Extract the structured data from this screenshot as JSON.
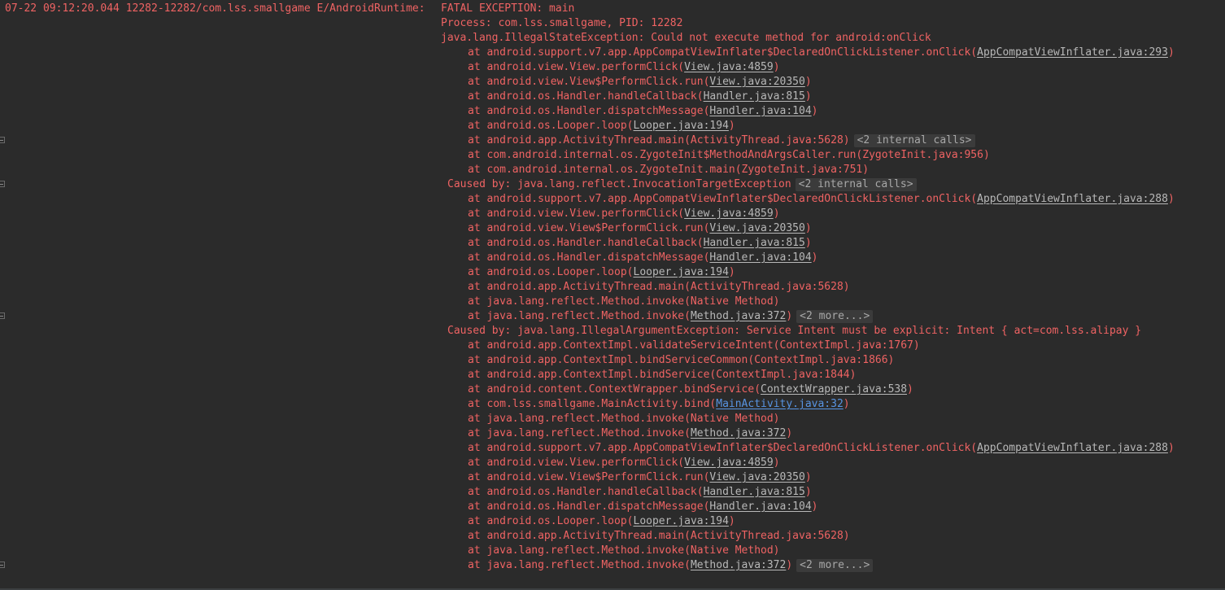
{
  "header": {
    "prefix": "07-22 09:12:20.044 12282-12282/com.lss.smallgame E/AndroidRuntime: ",
    "fatal": "FATAL EXCEPTION: main"
  },
  "lines": [
    {
      "kind": "header"
    },
    {
      "indent": 0,
      "text": "Process: com.lss.smallgame, PID: 12282"
    },
    {
      "indent": 0,
      "text": "java.lang.IllegalStateException: Could not execute method for android:onClick"
    },
    {
      "indent": 2,
      "text": "at android.support.v7.app.AppCompatViewInflater$DeclaredOnClickListener.onClick(",
      "link": "AppCompatViewInflater.java:293",
      "after": ")"
    },
    {
      "indent": 2,
      "text": "at android.view.View.performClick(",
      "link": "View.java:4859",
      "after": ")"
    },
    {
      "indent": 2,
      "text": "at android.view.View$PerformClick.run(",
      "link": "View.java:20350",
      "after": ")"
    },
    {
      "indent": 2,
      "text": "at android.os.Handler.handleCallback(",
      "link": "Handler.java:815",
      "after": ")"
    },
    {
      "indent": 2,
      "text": "at android.os.Handler.dispatchMessage(",
      "link": "Handler.java:104",
      "after": ")"
    },
    {
      "indent": 2,
      "text": "at android.os.Looper.loop(",
      "link": "Looper.java:194",
      "after": ")"
    },
    {
      "indent": 2,
      "text": "at android.app.ActivityThread.main(ActivityThread.java:5628)",
      "fold": "<2 internal calls>",
      "foldable": true
    },
    {
      "indent": 2,
      "text": "at com.android.internal.os.ZygoteInit$MethodAndArgsCaller.run(ZygoteInit.java:956)"
    },
    {
      "indent": 2,
      "text": "at com.android.internal.os.ZygoteInit.main(ZygoteInit.java:751)"
    },
    {
      "indent": 1,
      "text": "Caused by: java.lang.reflect.InvocationTargetException",
      "fold": "<2 internal calls>",
      "foldable": true
    },
    {
      "indent": 2,
      "text": "at android.support.v7.app.AppCompatViewInflater$DeclaredOnClickListener.onClick(",
      "link": "AppCompatViewInflater.java:288",
      "after": ")"
    },
    {
      "indent": 2,
      "text": "at android.view.View.performClick(",
      "link": "View.java:4859",
      "after": ")"
    },
    {
      "indent": 2,
      "text": "at android.view.View$PerformClick.run(",
      "link": "View.java:20350",
      "after": ")"
    },
    {
      "indent": 2,
      "text": "at android.os.Handler.handleCallback(",
      "link": "Handler.java:815",
      "after": ")"
    },
    {
      "indent": 2,
      "text": "at android.os.Handler.dispatchMessage(",
      "link": "Handler.java:104",
      "after": ")"
    },
    {
      "indent": 2,
      "text": "at android.os.Looper.loop(",
      "link": "Looper.java:194",
      "after": ")"
    },
    {
      "indent": 2,
      "text": "at android.app.ActivityThread.main(ActivityThread.java:5628)"
    },
    {
      "indent": 2,
      "text": "at java.lang.reflect.Method.invoke(Native Method)"
    },
    {
      "indent": 2,
      "text": "at java.lang.reflect.Method.invoke(",
      "link": "Method.java:372",
      "after": ")",
      "fold": "<2 more...>",
      "foldable": true
    },
    {
      "indent": 1,
      "text": "Caused by: java.lang.IllegalArgumentException: Service Intent must be explicit: Intent { act=com.lss.alipay }"
    },
    {
      "indent": 2,
      "text": "at android.app.ContextImpl.validateServiceIntent(ContextImpl.java:1767)"
    },
    {
      "indent": 2,
      "text": "at android.app.ContextImpl.bindServiceCommon(ContextImpl.java:1866)"
    },
    {
      "indent": 2,
      "text": "at android.app.ContextImpl.bindService(ContextImpl.java:1844)"
    },
    {
      "indent": 2,
      "text": "at android.content.ContextWrapper.bindService(",
      "link": "ContextWrapper.java:538",
      "after": ")"
    },
    {
      "indent": 2,
      "text": "at com.lss.smallgame.MainActivity.bind(",
      "link": "MainActivity.java:32",
      "after": ")",
      "userLink": true
    },
    {
      "indent": 2,
      "text": "at java.lang.reflect.Method.invoke(Native Method)"
    },
    {
      "indent": 2,
      "text": "at java.lang.reflect.Method.invoke(",
      "link": "Method.java:372",
      "after": ")"
    },
    {
      "indent": 2,
      "text": "at android.support.v7.app.AppCompatViewInflater$DeclaredOnClickListener.onClick(",
      "link": "AppCompatViewInflater.java:288",
      "after": ")"
    },
    {
      "indent": 2,
      "text": "at android.view.View.performClick(",
      "link": "View.java:4859",
      "after": ")"
    },
    {
      "indent": 2,
      "text": "at android.view.View$PerformClick.run(",
      "link": "View.java:20350",
      "after": ")"
    },
    {
      "indent": 2,
      "text": "at android.os.Handler.handleCallback(",
      "link": "Handler.java:815",
      "after": ")"
    },
    {
      "indent": 2,
      "text": "at android.os.Handler.dispatchMessage(",
      "link": "Handler.java:104",
      "after": ")"
    },
    {
      "indent": 2,
      "text": "at android.os.Looper.loop(",
      "link": "Looper.java:194",
      "after": ")"
    },
    {
      "indent": 2,
      "text": "at android.app.ActivityThread.main(ActivityThread.java:5628)"
    },
    {
      "indent": 2,
      "text": "at java.lang.reflect.Method.invoke(Native Method)"
    },
    {
      "indent": 2,
      "text": "at java.lang.reflect.Method.invoke(",
      "link": "Method.java:372",
      "after": ")",
      "fold": "<2 more...>",
      "foldable": true
    }
  ],
  "colors": {
    "background": "#2b2b2b",
    "error_text": "#ef6363",
    "link_text": "#b8b8b8",
    "user_link": "#5894e2",
    "fold_marker_bg": "#3b3b3b"
  },
  "icons": {
    "fold": "fold-expand-icon"
  }
}
